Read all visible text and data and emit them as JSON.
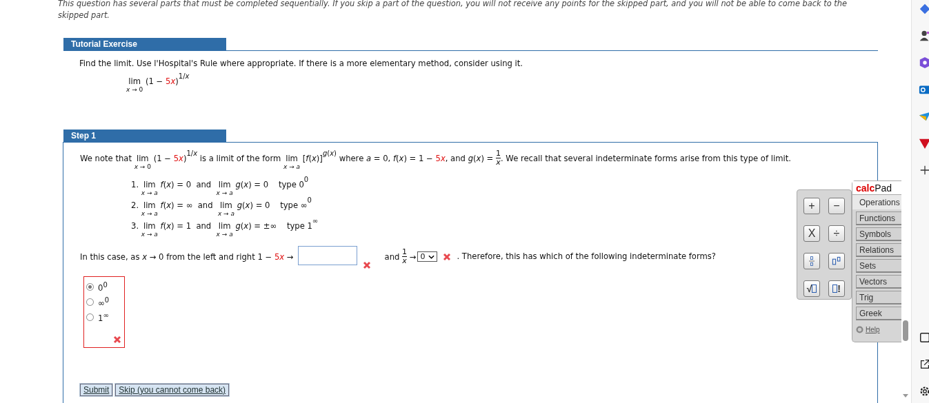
{
  "instructions": "This question has several parts that must be completed sequentially. If you skip a part of the question, you will not receive any points for the skipped part, and you will not be able to come back to the skipped part.",
  "tutorial": {
    "header": "Tutorial Exercise",
    "prompt": "Find the limit. Use l'Hospital's Rule where appropriate. If there is a more elementary method, consider using it.",
    "expression": [
      {
        "kind": "lim",
        "text": "lim",
        "sub": "*x* → 0"
      },
      {
        "kind": "text",
        "text": " (1 − "
      },
      {
        "kind": "red",
        "text": "5"
      },
      {
        "kind": "red_italic",
        "text": "x"
      },
      {
        "kind": "text",
        "text": ")"
      },
      {
        "kind": "sup",
        "text": "1/*x*"
      }
    ]
  },
  "step": {
    "header": "Step 1",
    "sentence": [
      {
        "kind": "text",
        "text": "We note that "
      },
      {
        "kind": "lim",
        "text": "lim",
        "sub": "*x* → 0"
      },
      {
        "kind": "text",
        "text": " (1 − "
      },
      {
        "kind": "red",
        "text": "5"
      },
      {
        "kind": "red_italic",
        "text": "x"
      },
      {
        "kind": "text",
        "text": ")"
      },
      {
        "kind": "sup",
        "text": "1/*x*"
      },
      {
        "kind": "text",
        "text": " is a limit of the form "
      },
      {
        "kind": "lim",
        "text": "lim",
        "sub": "*x* → *a*"
      },
      {
        "kind": "text",
        "text": " [*f*(*x*)]"
      },
      {
        "kind": "sup",
        "text": "*g*(*x*)"
      },
      {
        "kind": "text",
        "text": " where *a* = 0, *f*(*x*) = 1 − "
      },
      {
        "kind": "red",
        "text": "5"
      },
      {
        "kind": "red_italic",
        "text": "x"
      },
      {
        "kind": "text",
        "text": ", and *g*(*x*) = "
      },
      {
        "kind": "frac",
        "num": "1",
        "den": "*x*"
      },
      {
        "kind": "text",
        "text": ". We recall that several indeterminate forms arise from this type of limit."
      }
    ],
    "forms": [
      [
        {
          "kind": "text",
          "text": "1. "
        },
        {
          "kind": "lim",
          "text": "lim",
          "sub": "*x* → *a*"
        },
        {
          "kind": "text",
          "text": " *f*(*x*) = 0  and  "
        },
        {
          "kind": "lim",
          "text": "lim",
          "sub": "*x* → *a*"
        },
        {
          "kind": "text",
          "text": " *g*(*x*) = 0    type 0"
        },
        {
          "kind": "sup",
          "text": "0"
        }
      ],
      [
        {
          "kind": "text",
          "text": "2. "
        },
        {
          "kind": "lim",
          "text": "lim",
          "sub": "*x* → *a*"
        },
        {
          "kind": "text",
          "text": " *f*(*x*) = ∞  and  "
        },
        {
          "kind": "lim",
          "text": "lim",
          "sub": "*x* → *a*"
        },
        {
          "kind": "text",
          "text": " *g*(*x*) = 0    type ∞"
        },
        {
          "kind": "sup",
          "text": "0"
        }
      ],
      [
        {
          "kind": "text",
          "text": "3. "
        },
        {
          "kind": "lim",
          "text": "lim",
          "sub": "*x* → *a*"
        },
        {
          "kind": "text",
          "text": " *f*(*x*) = 1  and  "
        },
        {
          "kind": "lim",
          "text": "lim",
          "sub": "*x* → *a*"
        },
        {
          "kind": "text",
          "text": " *g*(*x*) = ±∞    type 1"
        },
        {
          "kind": "sup",
          "text": "∞"
        }
      ]
    ],
    "case_row": {
      "lead": [
        {
          "kind": "text",
          "text": "In this case, as *x* → 0 from the left and right 1 − "
        },
        {
          "kind": "red",
          "text": "5"
        },
        {
          "kind": "red_italic",
          "text": "x"
        },
        {
          "kind": "text",
          "text": " →"
        }
      ],
      "answer_field": {
        "correct": false
      },
      "middle": [
        {
          "kind": "text",
          "text": "and "
        },
        {
          "kind": "frac",
          "num": "1",
          "den": "*x*"
        },
        {
          "kind": "text",
          "text": " →"
        }
      ],
      "select": {
        "value": "0",
        "correct": false
      },
      "tail": ". Therefore, this has which of the following indeterminate forms?"
    },
    "options": [
      {
        "base": "0",
        "sup": "0",
        "selected": true
      },
      {
        "base": "∞",
        "sup": "0",
        "selected": false
      },
      {
        "base": "1",
        "sup": "∞",
        "selected": false
      }
    ],
    "options_correct": false
  },
  "buttons": [
    "Submit",
    "Skip (you cannot come back)"
  ],
  "calcpad": {
    "title_accent": "calc",
    "title": "Pad",
    "keys": [
      {
        "kind": "text",
        "label": "+"
      },
      {
        "kind": "text",
        "label": "−"
      },
      {
        "kind": "text",
        "label": "X"
      },
      {
        "kind": "text",
        "label": "÷"
      },
      {
        "kind": "fraction"
      },
      {
        "kind": "power"
      },
      {
        "kind": "sqrt",
        "label": "√"
      },
      {
        "kind": "factorial",
        "label": "!"
      }
    ],
    "tabs": [
      {
        "label": "Operations",
        "selected": true
      },
      {
        "label": "Functions",
        "selected": false
      },
      {
        "label": "Symbols",
        "selected": false
      },
      {
        "label": "Relations",
        "selected": false
      },
      {
        "label": "Sets",
        "selected": false
      },
      {
        "label": "Vectors",
        "selected": false
      },
      {
        "label": "Trig",
        "selected": false
      },
      {
        "label": "Greek",
        "selected": false
      }
    ],
    "help": "Help"
  }
}
